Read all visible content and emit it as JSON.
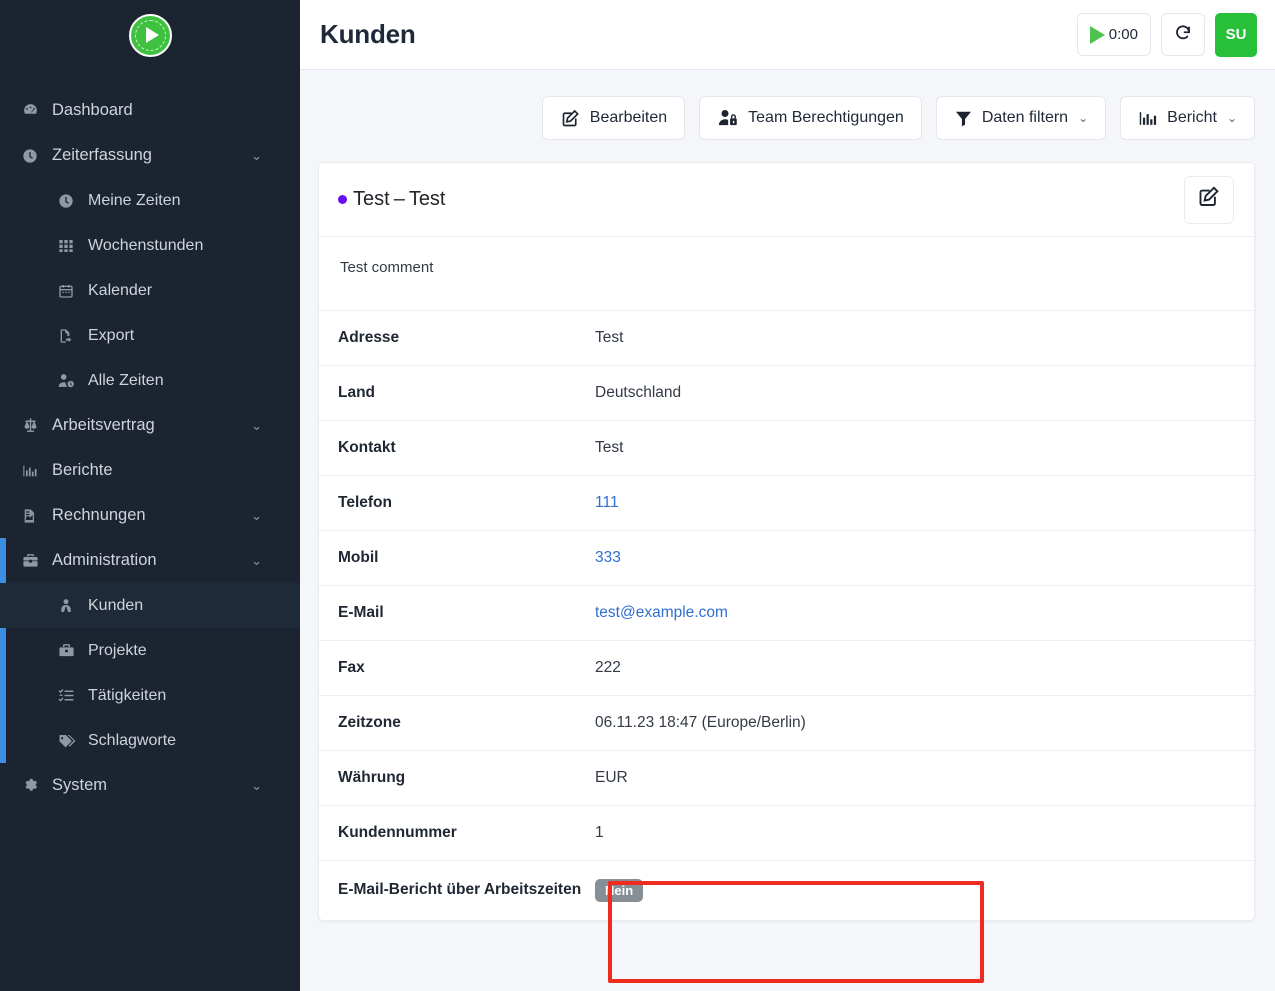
{
  "sidebar": {
    "logo": {
      "icon": "play-clock-logo-icon"
    },
    "items": [
      {
        "label": "Dashboard",
        "icon": "dashboard-icon",
        "level": "top",
        "chevron": false
      },
      {
        "label": "Zeiterfassung",
        "icon": "clock-icon",
        "level": "top",
        "chevron": true
      },
      {
        "label": "Meine Zeiten",
        "icon": "clock-icon",
        "level": "sub",
        "chevron": false
      },
      {
        "label": "Wochenstunden",
        "icon": "grid-icon",
        "level": "sub",
        "chevron": false
      },
      {
        "label": "Kalender",
        "icon": "calendar-icon",
        "level": "sub",
        "chevron": false
      },
      {
        "label": "Export",
        "icon": "file-export-icon",
        "level": "sub",
        "chevron": false
      },
      {
        "label": "Alle Zeiten",
        "icon": "user-clock-icon",
        "level": "sub",
        "chevron": false
      },
      {
        "label": "Arbeitsvertrag",
        "icon": "scales-icon",
        "level": "top",
        "chevron": true
      },
      {
        "label": "Berichte",
        "icon": "bar-chart-icon",
        "level": "top",
        "chevron": false
      },
      {
        "label": "Rechnungen",
        "icon": "invoice-icon",
        "level": "top",
        "chevron": true
      },
      {
        "label": "Administration",
        "icon": "toolbox-icon",
        "level": "top",
        "chevron": true
      },
      {
        "label": "Kunden",
        "icon": "user-tie-icon",
        "level": "sub",
        "chevron": false,
        "active": true
      },
      {
        "label": "Projekte",
        "icon": "briefcase-icon",
        "level": "sub",
        "chevron": false
      },
      {
        "label": "Tätigkeiten",
        "icon": "task-list-icon",
        "level": "sub",
        "chevron": false
      },
      {
        "label": "Schlagworte",
        "icon": "tags-icon",
        "level": "sub",
        "chevron": false
      },
      {
        "label": "System",
        "icon": "gear-icon",
        "level": "top",
        "chevron": true
      }
    ],
    "accent_color": "#3b8fe0",
    "background_color": "#1b2430"
  },
  "header": {
    "title": "Kunden",
    "timer_label": "0:00",
    "reload_icon": "reload-icon",
    "avatar_initials": "SU",
    "avatar_color": "#28c038"
  },
  "toolbar": {
    "buttons": [
      {
        "label": "Bearbeiten",
        "icon": "edit-pencil-icon",
        "caret": false
      },
      {
        "label": "Team Berechtigungen",
        "icon": "user-lock-icon",
        "caret": false
      },
      {
        "label": "Daten filtern",
        "icon": "funnel-icon",
        "caret": true
      },
      {
        "label": "Bericht",
        "icon": "bar-chart-icon",
        "caret": true
      }
    ],
    "caret_glyph": "⌄"
  },
  "card": {
    "dot_color": "#6610f2",
    "title_primary": "Test",
    "title_separator": "–",
    "title_secondary": "Test",
    "edit_icon": "edit-square-icon",
    "comment": "Test comment",
    "rows": [
      {
        "key": "Adresse",
        "value": "Test",
        "type": "text"
      },
      {
        "key": "Land",
        "value": "Deutschland",
        "type": "text"
      },
      {
        "key": "Kontakt",
        "value": "Test",
        "type": "text"
      },
      {
        "key": "Telefon",
        "value": "111",
        "type": "link"
      },
      {
        "key": "Mobil",
        "value": "333",
        "type": "link"
      },
      {
        "key": "E-Mail",
        "value": "test@example.com",
        "type": "link"
      },
      {
        "key": "Fax",
        "value": "222",
        "type": "text"
      },
      {
        "key": "Zeitzone",
        "value": "06.11.23 18:47 (Europe/Berlin)",
        "type": "text"
      },
      {
        "key": "Währung",
        "value": "EUR",
        "type": "text"
      },
      {
        "key": "Kundennummer",
        "value": "1",
        "type": "text"
      },
      {
        "key": "E-Mail-Bericht über Arbeitszeiten",
        "value": "Nein",
        "type": "badge"
      }
    ]
  },
  "annotation": {
    "color": "#ee2c1f",
    "target": "E-Mail-Bericht über Arbeitszeiten"
  }
}
